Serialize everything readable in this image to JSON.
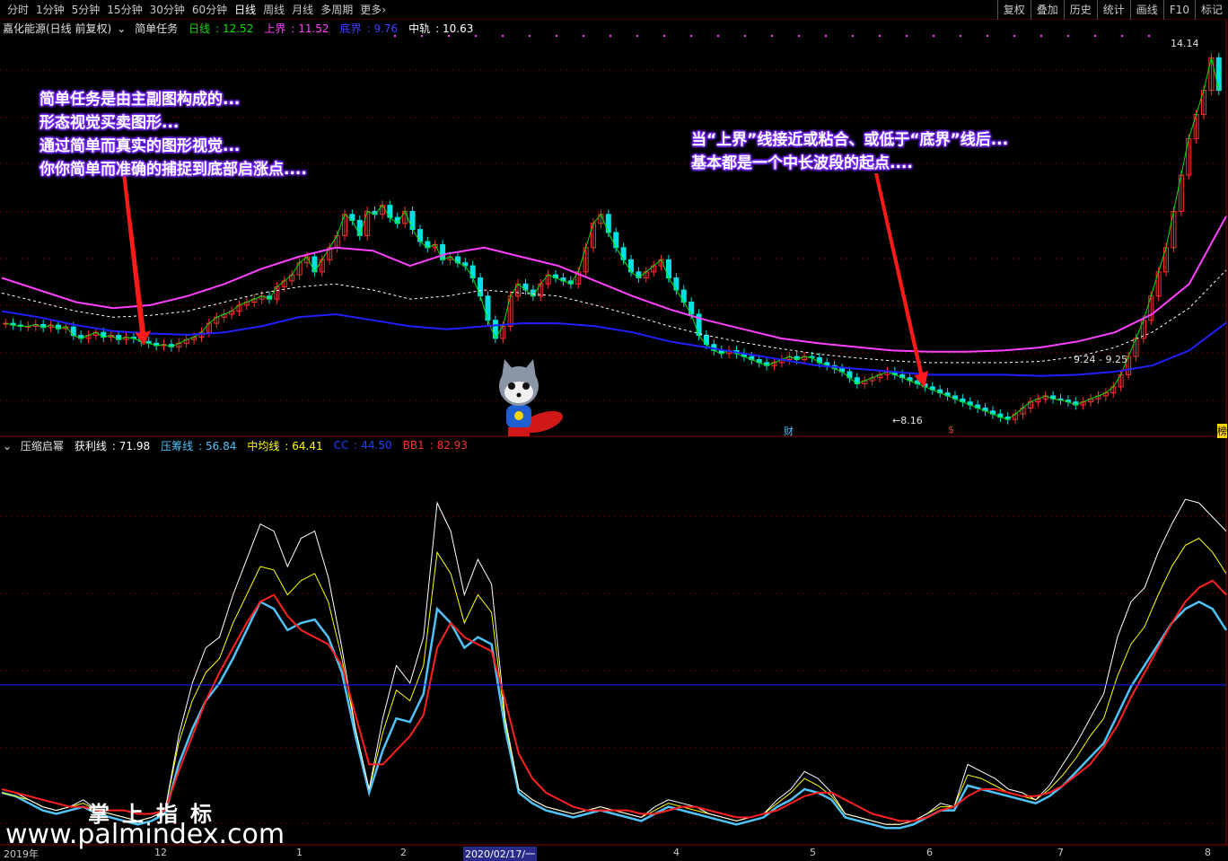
{
  "toolbar": {
    "periods": [
      "分时",
      "1分钟",
      "5分钟",
      "15分钟",
      "30分钟",
      "60分钟",
      "日线",
      "周线",
      "月线",
      "多周期",
      "更多"
    ],
    "active_period": "日线",
    "more_icon": "chevron-right-icon",
    "right_tools": [
      "复权",
      "叠加",
      "历史",
      "统计",
      "画线",
      "F10",
      "标记"
    ]
  },
  "info": {
    "stock": "嘉化能源(日线 前复权)",
    "indicator_icon": "chevron-down-circle-icon",
    "indicator": "简单任务",
    "ri_label": "日线",
    "ri_value": "12.52",
    "up_label": "上界",
    "up_value": "11.52",
    "dn_label": "底界",
    "dn_value": "9.76",
    "mid_label": "中轨",
    "mid_value": "10.63"
  },
  "sub": {
    "icon": "chevron-down-circle-icon",
    "name": "压缩启幂",
    "hl_label": "获利线",
    "hl_value": "71.98",
    "yc_label": "压筹线",
    "yc_value": "56.84",
    "zj_label": "中均线",
    "zj_value": "64.41",
    "cc_label": "CC",
    "cc_value": "44.50",
    "bb_label": "BB1",
    "bb_value": "82.93"
  },
  "annotations": {
    "left": [
      "简单任务是由主副图构成的...",
      "形态视觉买卖图形...",
      "通过简单而真实的图形视觉...",
      "你你简单而准确的捕捉到底部启涨点...."
    ],
    "right": [
      "当“上界”线接近或粘合、或低于“底界”线后...",
      "基本都是一个中长波段的起点...."
    ]
  },
  "price_labels": {
    "high": "14.14",
    "low": "8.16",
    "range": "9.24 - 9.25",
    "marker_cai": "财",
    "marker_s": "$",
    "marker_right": "榜"
  },
  "xaxis": {
    "labels": [
      "2019年",
      "12",
      "1",
      "2",
      "2020/02/17/一",
      "4",
      "5",
      "6",
      "7",
      "8"
    ],
    "cursor": "2020/02/17/一"
  },
  "watermark": {
    "cn": "掌上指标",
    "url": "www.palmindex.com"
  },
  "colors": {
    "up_candle": "#ff3030",
    "down_candle": "#00e0e0",
    "ri_line": "#00e000",
    "upper_line": "#ff40ff",
    "bottom_line": "#2020ff",
    "mid_line": "#ffffff",
    "hl_line": "#ffffff",
    "yc_line": "#4fc3f7",
    "zj_line": "#ffff00",
    "bb_line": "#ff2020",
    "cc_line": "#2020ff"
  },
  "chart_data": [
    {
      "type": "line",
      "panel": "main",
      "title": "嘉化能源(日线 前复权) 简单任务",
      "notes": "candlestick price chart with channel lines; values read approximately from pixels",
      "x_labels": [
        "2019年",
        "12",
        "1",
        "2",
        "4",
        "5",
        "6",
        "7",
        "8"
      ],
      "series": [
        {
          "name": "价格",
          "values": [
            9.75,
            9.72,
            9.7,
            9.7,
            9.73,
            9.68,
            9.72,
            9.66,
            9.69,
            9.55,
            9.5,
            9.55,
            9.6,
            9.52,
            9.55,
            9.48,
            9.52,
            9.5,
            9.45,
            9.42,
            9.38,
            9.4,
            9.36,
            9.42,
            9.48,
            9.52,
            9.6,
            9.75,
            9.85,
            9.9,
            9.95,
            10.05,
            10.1,
            10.15,
            10.2,
            10.15,
            10.35,
            10.45,
            10.55,
            10.75,
            10.85,
            10.6,
            10.8,
            11.0,
            11.2,
            11.55,
            11.45,
            11.2,
            11.6,
            11.55,
            11.7,
            11.5,
            11.4,
            11.6,
            11.3,
            11.1,
            11.0,
            11.05,
            10.8,
            10.85,
            10.75,
            10.7,
            10.5,
            10.2,
            9.8,
            9.5,
            9.7,
            10.2,
            10.4,
            10.3,
            10.2,
            10.4,
            10.55,
            10.5,
            10.45,
            10.4,
            10.6,
            11.0,
            11.4,
            11.55,
            11.25,
            11.0,
            10.8,
            10.6,
            10.5,
            10.6,
            10.7,
            10.8,
            10.5,
            10.3,
            10.1,
            9.9,
            9.55,
            9.4,
            9.3,
            9.25,
            9.3,
            9.25,
            9.2,
            9.15,
            9.1,
            9.05,
            9.1,
            9.15,
            9.2,
            9.15,
            9.2,
            9.18,
            9.1,
            9.05,
            9.0,
            8.95,
            8.85,
            8.75,
            8.8,
            8.85,
            8.9,
            8.95,
            8.9,
            8.85,
            8.8,
            8.75,
            8.7,
            8.65,
            8.6,
            8.55,
            8.5,
            8.45,
            8.4,
            8.35,
            8.3,
            8.25,
            8.2,
            8.16,
            8.25,
            8.35,
            8.45,
            8.5,
            8.55,
            8.5,
            8.48,
            8.45,
            8.4,
            8.45,
            8.5,
            8.55,
            8.6,
            8.7,
            8.9,
            9.2,
            9.5,
            9.8,
            10.2,
            10.6,
            11.0,
            11.6,
            12.2,
            12.8,
            13.2,
            13.6,
            14.14,
            13.6
          ]
        },
        {
          "name": "上界",
          "values": [
            10.5,
            10.3,
            10.1,
            10.0,
            10.05,
            10.2,
            10.4,
            10.65,
            10.85,
            11.0,
            10.95,
            10.7,
            10.9,
            11.0,
            10.85,
            10.7,
            10.45,
            10.2,
            9.98,
            9.8,
            9.65,
            9.5,
            9.42,
            9.36,
            9.3,
            9.28,
            9.28,
            9.3,
            9.35,
            9.45,
            9.6,
            9.9,
            10.4,
            11.52
          ]
        },
        {
          "name": "底界",
          "values": [
            9.95,
            9.85,
            9.72,
            9.62,
            9.58,
            9.56,
            9.6,
            9.7,
            9.85,
            9.9,
            9.8,
            9.7,
            9.65,
            9.7,
            9.75,
            9.75,
            9.7,
            9.6,
            9.45,
            9.35,
            9.25,
            9.15,
            9.05,
            9.0,
            8.95,
            8.9,
            8.9,
            8.9,
            8.88,
            8.9,
            8.95,
            9.05,
            9.3,
            9.76
          ]
        },
        {
          "name": "中轨",
          "values": [
            10.25,
            10.1,
            9.95,
            9.85,
            9.88,
            9.95,
            10.1,
            10.25,
            10.35,
            10.4,
            10.3,
            10.15,
            10.2,
            10.3,
            10.25,
            10.2,
            10.05,
            9.88,
            9.7,
            9.55,
            9.43,
            9.33,
            9.24,
            9.18,
            9.13,
            9.1,
            9.1,
            9.1,
            9.12,
            9.2,
            9.35,
            9.6,
            10.0,
            10.63
          ]
        }
      ],
      "ylim": [
        8.0,
        14.5
      ]
    },
    {
      "type": "line",
      "panel": "sub",
      "title": "压缩启幂",
      "series": [
        {
          "name": "获利线",
          "values": [
            15,
            14,
            12,
            10,
            9,
            10,
            12,
            9,
            8,
            7,
            6,
            7,
            9,
            30,
            45,
            55,
            58,
            70,
            80,
            90,
            88,
            78,
            86,
            88,
            75,
            55,
            32,
            15,
            35,
            50,
            45,
            58,
            96,
            88,
            70,
            80,
            73,
            35,
            15,
            12,
            10,
            9,
            8,
            9,
            10,
            9,
            8,
            7,
            10,
            12,
            11,
            10,
            8,
            7,
            6,
            7,
            8,
            12,
            15,
            20,
            18,
            14,
            8,
            7,
            6,
            5,
            5,
            6,
            8,
            11,
            10,
            22,
            20,
            18,
            15,
            14,
            12,
            16,
            22,
            28,
            35,
            42,
            58,
            68,
            72,
            82,
            90,
            97,
            96,
            92,
            88
          ]
        },
        {
          "name": "压筹线",
          "values": [
            14,
            13,
            11,
            9,
            8,
            9,
            10,
            8,
            7,
            6,
            5,
            6,
            8,
            22,
            32,
            40,
            45,
            52,
            60,
            68,
            66,
            60,
            62,
            63,
            58,
            48,
            30,
            14,
            26,
            35,
            34,
            42,
            66,
            62,
            55,
            58,
            56,
            32,
            14,
            11,
            9,
            8,
            7,
            8,
            9,
            8,
            7,
            6,
            8,
            10,
            9,
            8,
            7,
            6,
            5,
            6,
            7,
            10,
            12,
            15,
            14,
            12,
            7,
            6,
            5,
            4,
            4,
            5,
            7,
            9,
            9,
            16,
            15,
            14,
            13,
            12,
            11,
            13,
            16,
            20,
            24,
            28,
            36,
            44,
            50,
            56,
            62,
            66,
            68,
            66,
            60
          ]
        },
        {
          "name": "中均线",
          "values": [
            14,
            13,
            12,
            10,
            9,
            10,
            11,
            9,
            8,
            7,
            6,
            7,
            9,
            28,
            40,
            48,
            52,
            62,
            70,
            78,
            77,
            70,
            74,
            76,
            68,
            52,
            32,
            15,
            31,
            43,
            40,
            50,
            82,
            76,
            62,
            70,
            65,
            34,
            15,
            12,
            10,
            9,
            8,
            9,
            10,
            9,
            8,
            7,
            9,
            11,
            10,
            9,
            8,
            7,
            6,
            7,
            8,
            11,
            14,
            18,
            16,
            13,
            8,
            7,
            6,
            5,
            5,
            6,
            8,
            10,
            10,
            19,
            18,
            16,
            14,
            13,
            12,
            15,
            19,
            24,
            30,
            35,
            47,
            56,
            61,
            70,
            78,
            84,
            86,
            82,
            76
          ]
        },
        {
          "name": "BB1",
          "values": [
            15,
            14,
            13,
            12,
            11,
            10,
            10,
            9,
            9,
            9,
            8,
            8,
            9,
            20,
            30,
            40,
            48,
            55,
            62,
            68,
            70,
            64,
            60,
            58,
            56,
            50,
            36,
            22,
            22,
            26,
            30,
            36,
            55,
            62,
            58,
            56,
            54,
            40,
            25,
            18,
            14,
            12,
            10,
            9,
            9,
            9,
            9,
            8,
            8,
            9,
            10,
            10,
            9,
            8,
            7,
            7,
            8,
            9,
            11,
            13,
            14,
            14,
            12,
            10,
            8,
            7,
            6,
            6,
            7,
            9,
            10,
            13,
            15,
            15,
            14,
            13,
            13,
            14,
            16,
            19,
            22,
            27,
            33,
            41,
            48,
            55,
            62,
            68,
            72,
            74,
            70
          ]
        },
        {
          "name": "CC",
          "values": [
            44.5,
            44.5
          ]
        }
      ],
      "ylim": [
        0,
        110
      ]
    }
  ]
}
